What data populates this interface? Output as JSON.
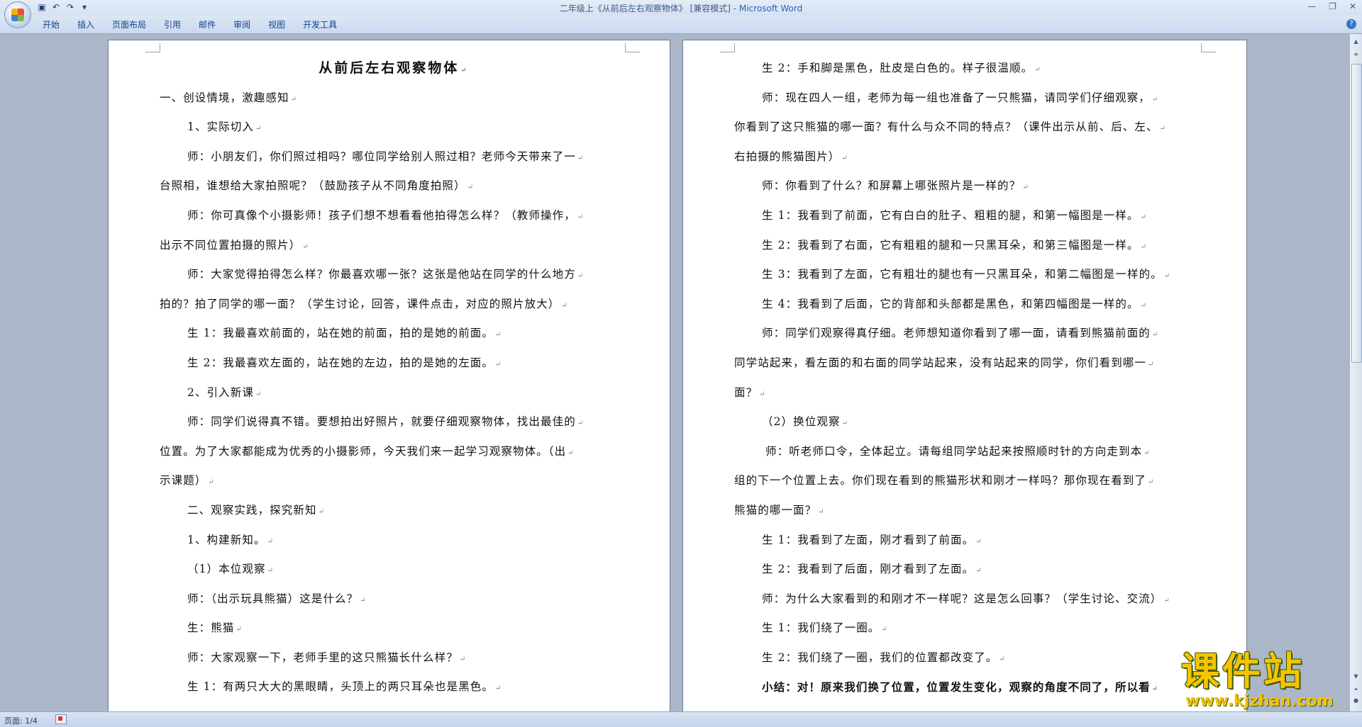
{
  "window": {
    "title": "二年级上《从前后左右观察物体》 [兼容模式] - ",
    "app_name": "Microsoft Word"
  },
  "quick_access": {
    "icons": [
      "save-icon",
      "undo-icon",
      "redo-icon",
      "customize-icon"
    ]
  },
  "ribbon": {
    "tabs": [
      {
        "label": "开始"
      },
      {
        "label": "插入"
      },
      {
        "label": "页面布局"
      },
      {
        "label": "引用"
      },
      {
        "label": "邮件"
      },
      {
        "label": "审阅"
      },
      {
        "label": "视图"
      },
      {
        "label": "开发工具"
      }
    ]
  },
  "document": {
    "left_page": [
      {
        "text": "从前后左右观察物体",
        "style": "title"
      },
      {
        "text": "一、创设情境，激趣感知",
        "style": ""
      },
      {
        "text": "1、实际切入",
        "style": "ind1"
      },
      {
        "text": "师：小朋友们，你们照过相吗？哪位同学给别人照过相？老师今天带来了一",
        "style": "ind1"
      },
      {
        "text": "台照相，谁想给大家拍照呢？（鼓励孩子从不同角度拍照）",
        "style": ""
      },
      {
        "text": "师：你可真像个小摄影师！孩子们想不想看看他拍得怎么样？（教师操作，",
        "style": "ind1"
      },
      {
        "text": "出示不同位置拍摄的照片）",
        "style": ""
      },
      {
        "text": "师：大家觉得拍得怎么样？你最喜欢哪一张？这张是他站在同学的什么地方",
        "style": "ind1"
      },
      {
        "text": "拍的？拍了同学的哪一面？（学生讨论，回答，课件点击，对应的照片放大）",
        "style": ""
      },
      {
        "text": "生 1：我最喜欢前面的，站在她的前面，拍的是她的前面。",
        "style": "ind1"
      },
      {
        "text": "生 2：我最喜欢左面的，站在她的左边，拍的是她的左面。",
        "style": "ind1"
      },
      {
        "text": "2、引入新课",
        "style": "ind1"
      },
      {
        "text": "师：同学们说得真不错。要想拍出好照片，就要仔细观察物体，找出最佳的",
        "style": "ind1"
      },
      {
        "text": "位置。为了大家都能成为优秀的小摄影师，今天我们来一起学习观察物体。（出",
        "style": ""
      },
      {
        "text": "示课题）",
        "style": ""
      },
      {
        "text": "二、观察实践，探究新知",
        "style": "ind1"
      },
      {
        "text": "1、构建新知。",
        "style": "ind1"
      },
      {
        "text": "（1）本位观察",
        "style": "ind1"
      },
      {
        "text": "师：（出示玩具熊猫）这是什么？",
        "style": "ind1"
      },
      {
        "text": "生：熊猫",
        "style": "ind1"
      },
      {
        "text": "师：大家观察一下，老师手里的这只熊猫长什么样？",
        "style": "ind1"
      },
      {
        "text": "生 1：有两只大大的黑眼睛，头顶上的两只耳朵也是黑色。",
        "style": "ind1"
      }
    ],
    "right_page": [
      {
        "text": "生 2：手和脚是黑色，肚皮是白色的。样子很温顺。",
        "style": "ind1"
      },
      {
        "text": "师：现在四人一组，老师为每一组也准备了一只熊猫，请同学们仔细观察，",
        "style": "ind1"
      },
      {
        "text": "你看到了这只熊猫的哪一面？有什么与众不同的特点？（课件出示从前、后、左、",
        "style": ""
      },
      {
        "text": "右拍摄的熊猫图片）",
        "style": ""
      },
      {
        "text": "师：你看到了什么？和屏幕上哪张照片是一样的？",
        "style": "ind1"
      },
      {
        "text": "生 1：我看到了前面，它有白白的肚子、粗粗的腿，和第一幅图是一样。",
        "style": "ind1"
      },
      {
        "text": "生 2：我看到了右面，它有粗粗的腿和一只黑耳朵，和第三幅图是一样。",
        "style": "ind1"
      },
      {
        "text": "生 3：我看到了左面，它有粗壮的腿也有一只黑耳朵，和第二幅图是一样的。",
        "style": "ind1"
      },
      {
        "text": "生 4：我看到了后面，它的背部和头部都是黑色，和第四幅图是一样的。",
        "style": "ind1"
      },
      {
        "text": "师：同学们观察得真仔细。老师想知道你看到了哪一面，请看到熊猫前面的",
        "style": "ind1"
      },
      {
        "text": "同学站起来，看左面的和右面的同学站起来，没有站起来的同学，你们看到哪一",
        "style": ""
      },
      {
        "text": "面？",
        "style": ""
      },
      {
        "text": "（2）换位观察",
        "style": "ind1"
      },
      {
        "text": "师：听老师口令，全体起立。请每组同学站起来按照顺时针的方向走到本",
        "style": "ind2"
      },
      {
        "text": "组的下一个位置上去。你们现在看到的熊猫形状和刚才一样吗？那你现在看到了",
        "style": ""
      },
      {
        "text": "熊猫的哪一面？",
        "style": ""
      },
      {
        "text": "生 1：我看到了左面，刚才看到了前面。",
        "style": "ind1"
      },
      {
        "text": "生 2：我看到了后面，刚才看到了左面。",
        "style": "ind1"
      },
      {
        "text": "师：为什么大家看到的和刚才不一样呢？这是怎么回事？（学生讨论、交流）",
        "style": "ind1"
      },
      {
        "text": "生 1：我们绕了一圈。",
        "style": "ind1"
      },
      {
        "text": "生 2：我们绕了一圈，我们的位置都改变了。",
        "style": "ind1"
      },
      {
        "text": "小结：对！原来我们换了位置，位置发生变化，观察的角度不同了，所以看",
        "style": "ind1 bold"
      }
    ],
    "paragraph_mark": "↵"
  },
  "statusbar": {
    "page_info": "页面: 1/4"
  },
  "watermark": {
    "title": "课件站",
    "url": "www.kjzhan.com"
  },
  "colors": {
    "app_name": "#2d64b3",
    "ribbon_tab_text": "#15428b",
    "workspace_bg": "#abb6c8",
    "watermark": "#f6c400"
  }
}
